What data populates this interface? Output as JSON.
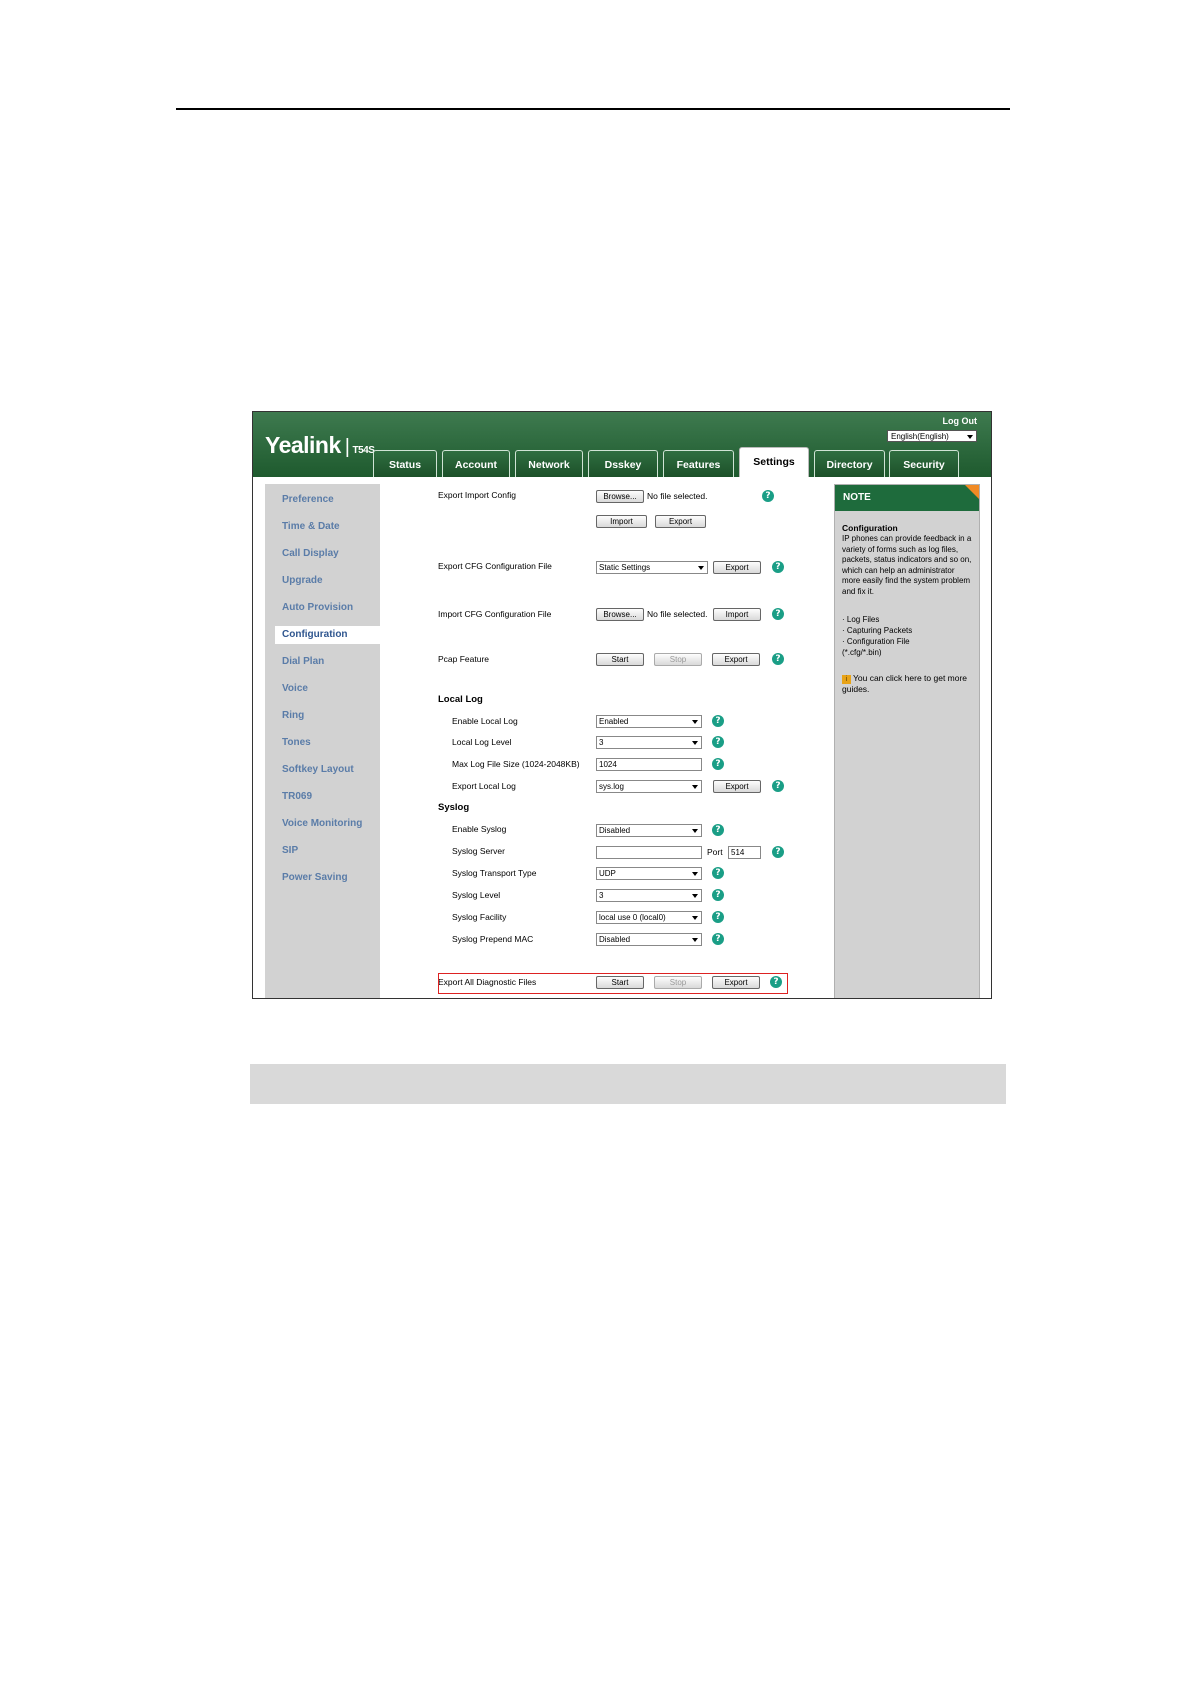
{
  "header": {
    "brand": "Yealink",
    "separator": "|",
    "model": "T54S",
    "logout": "Log Out",
    "language": "English(English)"
  },
  "tabs": [
    {
      "label": "Status"
    },
    {
      "label": "Account"
    },
    {
      "label": "Network"
    },
    {
      "label": "Dsskey"
    },
    {
      "label": "Features"
    },
    {
      "label": "Settings"
    },
    {
      "label": "Directory"
    },
    {
      "label": "Security"
    }
  ],
  "sidebar": {
    "items": [
      {
        "label": "Preference"
      },
      {
        "label": "Time & Date"
      },
      {
        "label": "Call Display"
      },
      {
        "label": "Upgrade"
      },
      {
        "label": "Auto Provision"
      },
      {
        "label": "Configuration"
      },
      {
        "label": "Dial Plan"
      },
      {
        "label": "Voice"
      },
      {
        "label": "Ring"
      },
      {
        "label": "Tones"
      },
      {
        "label": "Softkey Layout"
      },
      {
        "label": "TR069"
      },
      {
        "label": "Voice Monitoring"
      },
      {
        "label": "SIP"
      },
      {
        "label": "Power Saving"
      }
    ]
  },
  "config": {
    "export_import": {
      "label": "Export Import Config",
      "browse": "Browse...",
      "no_file": "No file selected.",
      "import": "Import",
      "export": "Export"
    },
    "export_cfg": {
      "label": "Export CFG Configuration File",
      "value": "Static Settings",
      "export": "Export"
    },
    "import_cfg": {
      "label": "Import CFG Configuration File",
      "browse": "Browse...",
      "no_file": "No file selected.",
      "import": "Import"
    },
    "pcap": {
      "label": "Pcap Feature",
      "start": "Start",
      "stop": "Stop",
      "export": "Export"
    },
    "local_log": {
      "title": "Local Log",
      "enable_label": "Enable Local Log",
      "enable_value": "Enabled",
      "level_label": "Local Log Level",
      "level_value": "3",
      "max_size_label": "Max Log File Size (1024-2048KB)",
      "max_size_value": "1024",
      "export_label": "Export Local Log",
      "export_value": "sys.log",
      "export": "Export"
    },
    "syslog": {
      "title": "Syslog",
      "enable_label": "Enable Syslog",
      "enable_value": "Disabled",
      "server_label": "Syslog Server",
      "server_value": "",
      "port_label": "Port",
      "port_value": "514",
      "transport_label": "Syslog Transport Type",
      "transport_value": "UDP",
      "level_label": "Syslog Level",
      "level_value": "3",
      "facility_label": "Syslog Facility",
      "facility_value": "local use 0 (local0)",
      "prepend_label": "Syslog Prepend MAC",
      "prepend_value": "Disabled"
    },
    "diagnostic": {
      "label": "Export All Diagnostic Files",
      "start": "Start",
      "stop": "Stop",
      "export": "Export"
    },
    "help_glyph": "?"
  },
  "note": {
    "header": "NOTE",
    "title": "Configuration",
    "body": "IP phones can provide feedback in a variety of forms such as log files, packets, status indicators and so on, which can help an administrator more easily find the system problem and fix it.",
    "bullets": [
      "· Log Files",
      "· Capturing Packets",
      "· Configuration File",
      "(*.cfg/*.bin)"
    ],
    "guide_icon": "i",
    "guide": "You can click here to get more guides."
  },
  "colors": {
    "header_green": "#1e5a2e",
    "note_green": "#1e6b3c",
    "sidebar_link": "#5a7ca8",
    "help_teal": "#1a9e86",
    "highlight_red": "#dd2222"
  }
}
